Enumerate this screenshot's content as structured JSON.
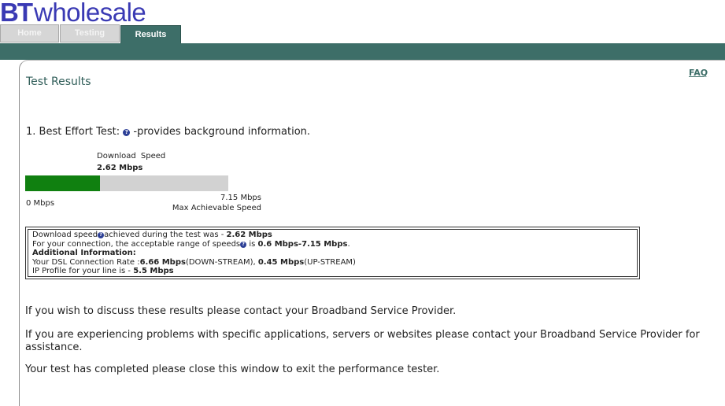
{
  "brand": {
    "bt": "BT",
    "wholesale": "wholesale"
  },
  "tabs": [
    {
      "label": "Home",
      "active": false
    },
    {
      "label": "Testing",
      "active": false
    },
    {
      "label": "Results",
      "active": true
    }
  ],
  "colors": {
    "brand_teal": "#3d6e68",
    "logo_blue": "#3a3ab4",
    "bar_fill": "#108010",
    "bar_track": "#d2d2d2"
  },
  "faq_label": "FAQ",
  "page_title": "Test Results",
  "best_effort": {
    "label": "1. Best Effort Test:",
    "help_icon": "question-icon",
    "suffix": "-provides background information."
  },
  "speed": {
    "download_label": "Download  Speed",
    "download_value": "2.62 Mbps",
    "progress_fraction": 0.3664,
    "min_label": "0 Mbps",
    "max_label": "7.15 Mbps",
    "max_caption": "Max Achievable Speed"
  },
  "info": {
    "line1_prefix": "Download speed",
    "line1_mid": "achieved during the test was - ",
    "line1_value": "2.62 Mbps",
    "line2_prefix": "For your connection, the acceptable range of speeds",
    "line2_mid": " is ",
    "line2_value": "0.6 Mbps-7.15 Mbps",
    "line2_suffix": ".",
    "additional_header": "Additional Information:",
    "line3_prefix": "Your DSL Connection Rate :",
    "downstream_value": "6.66 Mbps",
    "downstream_label": "(DOWN-STREAM), ",
    "upstream_value": "0.45 Mbps",
    "upstream_label": "(UP-STREAM)",
    "line4_prefix": "IP Profile for your line is - ",
    "ip_profile_value": "5.5 Mbps"
  },
  "messages": {
    "discuss": "If you wish to discuss these results please contact your Broadband Service Provider.",
    "problems": "If you are experiencing problems with specific applications, servers or websites please contact your Broadband Service Provider for assistance.",
    "completed": "Your test has completed please close this window to exit the performance tester."
  }
}
